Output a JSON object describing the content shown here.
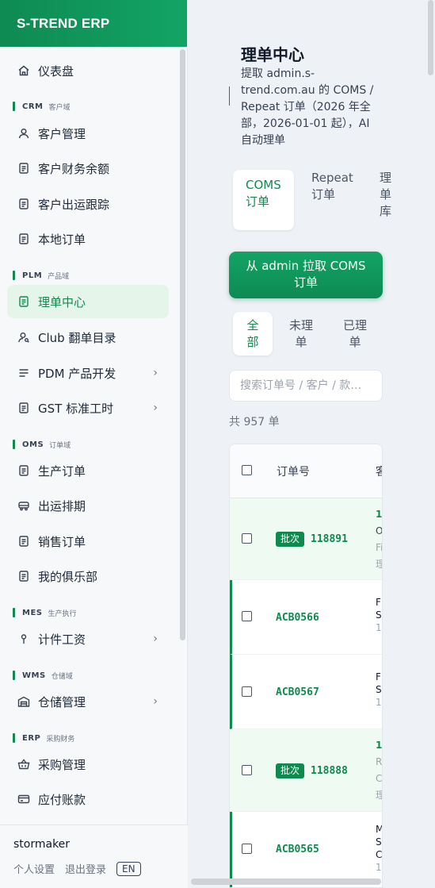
{
  "app": {
    "brand": "S-TREND ERP"
  },
  "sidebar": {
    "dashboard": "仪表盘",
    "sections": {
      "crm": {
        "code": "CRM",
        "desc": "客户域"
      },
      "plm": {
        "code": "PLM",
        "desc": "产品域"
      },
      "oms": {
        "code": "OMS",
        "desc": "订单域"
      },
      "mes": {
        "code": "MES",
        "desc": "生产执行"
      },
      "wms": {
        "code": "WMS",
        "desc": "仓储域"
      },
      "erp": {
        "code": "ERP",
        "desc": "采购财务"
      }
    },
    "items": {
      "customer_mgmt": "客户管理",
      "customer_balance": "客户财务余额",
      "customer_shipping": "客户出运跟踪",
      "local_orders": "本地订单",
      "order_center": "理单中心",
      "club_catalog": "Club 翻单目录",
      "pdm": "PDM 产品开发",
      "gst": "GST 标准工时",
      "production_orders": "生产订单",
      "shipping_schedule": "出运排期",
      "sales_orders": "销售订单",
      "my_club": "我的俱乐部",
      "piece_wage": "计件工资",
      "warehouse": "仓储管理",
      "purchasing": "采购管理",
      "payables": "应付账款"
    },
    "active": "order_center"
  },
  "user": {
    "name": "stormaker",
    "settings": "个人设置",
    "logout": "退出登录",
    "lang": "EN"
  },
  "page": {
    "title": "理单中心",
    "description": "提取 admin.s-trend.com.au 的 COMS / Repeat 订单（2026 年全部，2026-01-01 起），AI 自动理单",
    "tabs": {
      "coms": [
        "COMS",
        "订单"
      ],
      "repeat": [
        "Repeat",
        "订单"
      ],
      "library": [
        "理",
        "单",
        "库"
      ]
    },
    "pull_button": [
      "从 admin 拉取 COMS",
      "订单"
    ],
    "filters": {
      "all": [
        "全",
        "部"
      ],
      "unprocessed": [
        "未理",
        "单"
      ],
      "processed": [
        "已理",
        "单"
      ]
    },
    "search_placeholder": "搜索订单号 / 客户 / 款式...",
    "total": "共 957 单"
  },
  "table": {
    "columns": {
      "order_no": "订单号",
      "customer": "客"
    },
    "batch_label": "批次",
    "rows": [
      {
        "type": "batch",
        "order_no": "118891",
        "lines": [
          "1",
          "O",
          "Fi",
          "理"
        ]
      },
      {
        "type": "order",
        "order_no": "ACB0566",
        "lines": [
          "Fl",
          "S",
          "1"
        ]
      },
      {
        "type": "order",
        "order_no": "ACB0567",
        "lines": [
          "Fl",
          "S",
          "1"
        ]
      },
      {
        "type": "batch",
        "order_no": "118888",
        "lines": [
          "1",
          "R",
          "C",
          "理"
        ]
      },
      {
        "type": "order",
        "order_no": "ACB0565",
        "lines": [
          "M",
          "S",
          "C",
          "1"
        ]
      }
    ]
  },
  "colors": {
    "accent": "#0f8a4f",
    "active_bg": "#e5f5ea",
    "batch_bg": "#effaf3"
  },
  "icons": {
    "dashboard": "home-icon",
    "customer": "user-icon",
    "document": "document-icon",
    "club": "user-search-icon",
    "menu": "menu-lines-icon",
    "truck": "truck-icon",
    "pin": "pin-icon",
    "warehouse": "warehouse-icon",
    "basket": "basket-icon",
    "card": "card-icon"
  }
}
